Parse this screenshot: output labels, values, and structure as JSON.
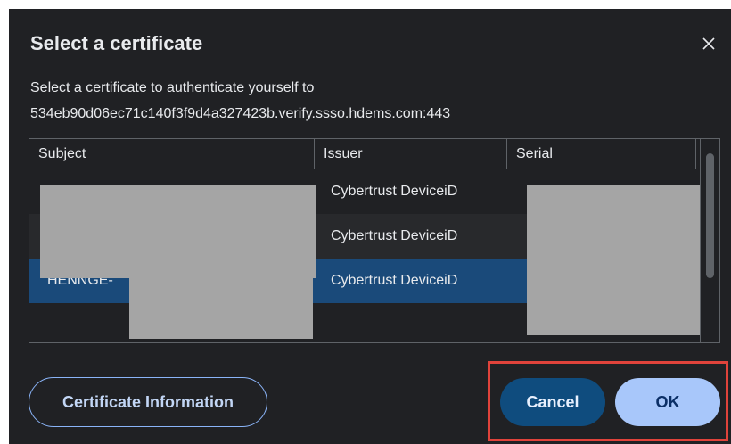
{
  "dialog": {
    "title": "Select a certificate",
    "description_line1": "Select a certificate to authenticate yourself to",
    "description_line2": "534eb90d06ec71c140f3f9d4a327423b.verify.ssso.hdems.com:443",
    "close_icon": "close-icon"
  },
  "table": {
    "columns": [
      "Subject",
      "Issuer",
      "Serial"
    ],
    "rows": [
      {
        "subject": "",
        "issuer": "Cybertrust DeviceiD",
        "serial": "",
        "selected": false
      },
      {
        "subject": "",
        "issuer": "Cybertrust DeviceiD",
        "serial": "",
        "selected": false
      },
      {
        "subject": "HENNGE-",
        "issuer": "Cybertrust DeviceiD",
        "serial": "",
        "selected": true
      }
    ]
  },
  "buttons": {
    "info": "Certificate Information",
    "cancel": "Cancel",
    "ok": "OK"
  },
  "colors": {
    "background": "#202124",
    "selected_row": "#1a4a7a",
    "ok_button": "#a8c7fa",
    "cancel_button": "#0f4c7e",
    "highlight": "#e0433b"
  }
}
